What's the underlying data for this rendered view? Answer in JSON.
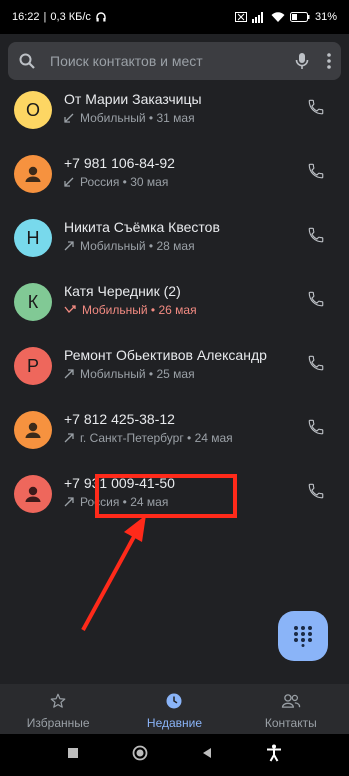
{
  "status_bar": {
    "time": "16:22",
    "speed": "0,3 КБ/с",
    "battery": "31%"
  },
  "search": {
    "placeholder": "Поиск контактов и мест",
    "icons": [
      "search-icon",
      "mic-icon",
      "more-vert-icon"
    ]
  },
  "calls": [
    {
      "avatar_letter": "О",
      "avatar_color": "#fdd663",
      "name": "От Марии Заказчицы",
      "direction": "incoming",
      "detail": "Мобильный • 31 мая",
      "missed": false
    },
    {
      "avatar_letter": "",
      "avatar_color": "#f6923f",
      "name": "+7 981 106-84-92",
      "direction": "incoming",
      "detail": "Россия • 30 мая",
      "missed": false
    },
    {
      "avatar_letter": "Н",
      "avatar_color": "#78d9ec",
      "name": "Никита Съёмка Квестов",
      "direction": "outgoing",
      "detail": "Мобильный • 28 мая",
      "missed": false
    },
    {
      "avatar_letter": "К",
      "avatar_color": "#81c995",
      "name": "Катя Чередник  (2)",
      "direction": "missed",
      "detail": "Мобильный • 26 мая",
      "missed": true
    },
    {
      "avatar_letter": "Р",
      "avatar_color": "#ee675c",
      "name": "Ремонт Обьективов Александр",
      "direction": "outgoing",
      "detail": "Мобильный • 25 мая",
      "missed": false
    },
    {
      "avatar_letter": "",
      "avatar_color": "#f6923f",
      "name": "+7 812 425-38-12",
      "direction": "outgoing",
      "detail": "г. Санкт-Петербург • 24 мая",
      "missed": false
    },
    {
      "avatar_letter": "",
      "avatar_color": "#ee675c",
      "name": "+7 931 009-41-50",
      "direction": "outgoing",
      "detail": "Россия • 24 мая",
      "missed": false
    }
  ],
  "bottom_nav": {
    "favorites": "Избранные",
    "recent": "Недавние",
    "contacts": "Контакты"
  },
  "colors": {
    "accent": "#8ab4f8",
    "missed": "#f28b82",
    "annotation": "#ff2a1a"
  }
}
